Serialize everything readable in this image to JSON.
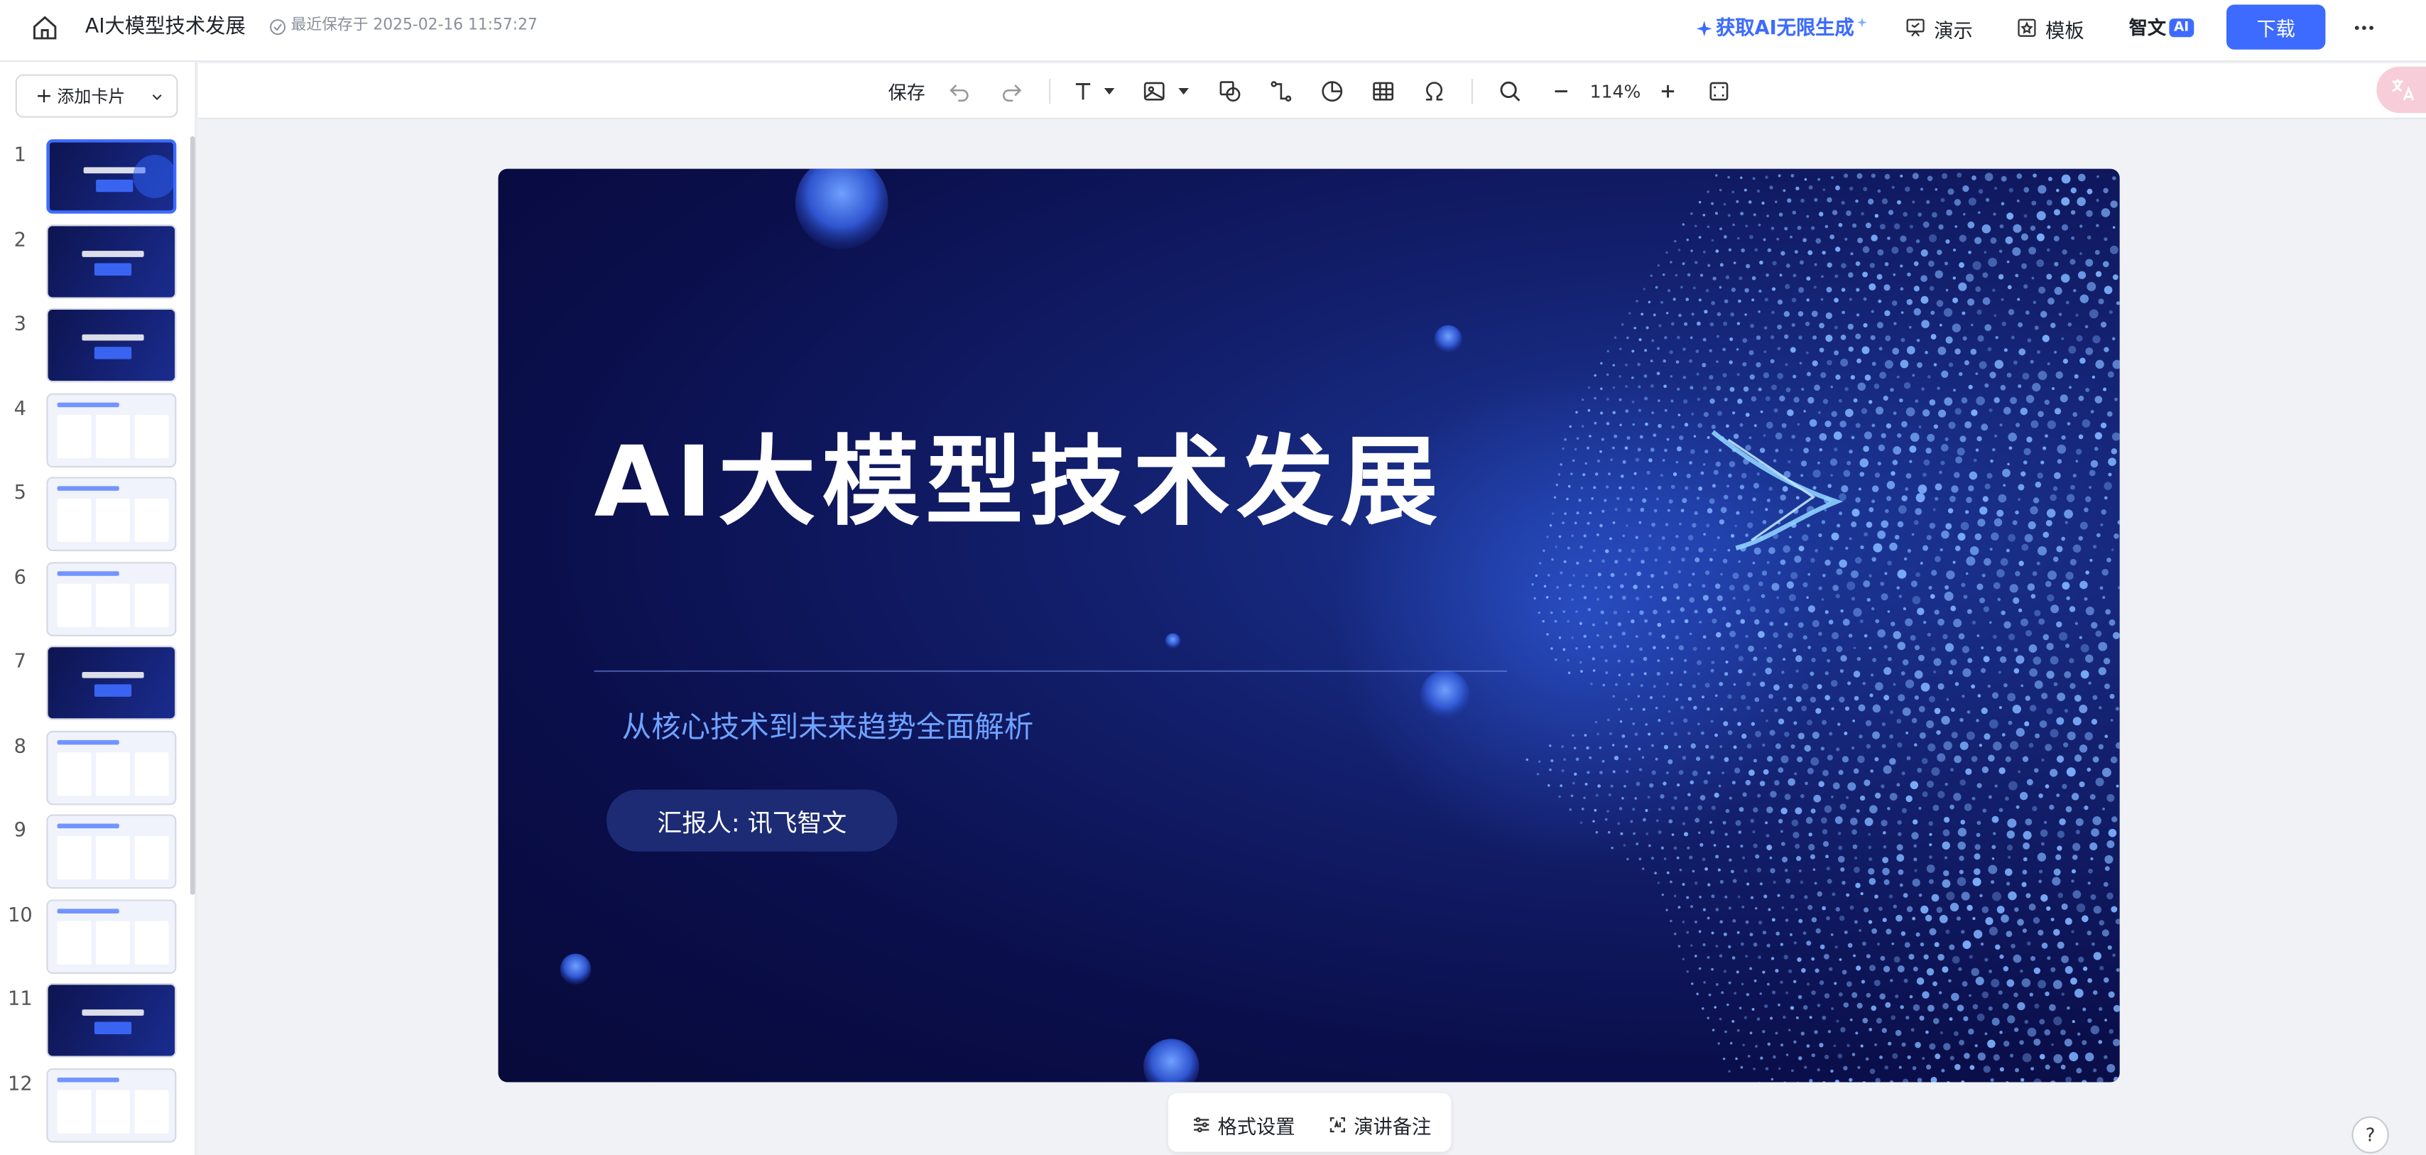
{
  "topbar": {
    "doc_title": "AI大模型技术发展",
    "saved_status": "最近保存于 2025-02-16 11:57:27",
    "ai_promo": "获取AI无限生成",
    "present_label": "演示",
    "template_label": "模板",
    "brand_label": "智文",
    "brand_tag": "AI",
    "download_label": "下载"
  },
  "sidebar": {
    "add_card_label": "添加卡片",
    "slides": [
      {
        "num": "1",
        "theme": "dark",
        "selected": true
      },
      {
        "num": "2",
        "theme": "dark"
      },
      {
        "num": "3",
        "theme": "dark"
      },
      {
        "num": "4",
        "theme": "light"
      },
      {
        "num": "5",
        "theme": "light"
      },
      {
        "num": "6",
        "theme": "light"
      },
      {
        "num": "7",
        "theme": "dark"
      },
      {
        "num": "8",
        "theme": "light"
      },
      {
        "num": "9",
        "theme": "light"
      },
      {
        "num": "10",
        "theme": "light"
      },
      {
        "num": "11",
        "theme": "dark"
      },
      {
        "num": "12",
        "theme": "light"
      }
    ]
  },
  "toolbar": {
    "save_label": "保存",
    "zoom": "114%"
  },
  "slide": {
    "title": "AI大模型技术发展",
    "subtitle": "从核心技术到未来趋势全面解析",
    "reporter": "汇报人: 讯飞智文"
  },
  "bottom": {
    "format_label": "格式设置",
    "notes_label": "演讲备注",
    "help": "?"
  },
  "colors": {
    "accent": "#3d6bff",
    "slide_bg": "#0a0e4a",
    "subtitle": "#6fa2ff"
  }
}
